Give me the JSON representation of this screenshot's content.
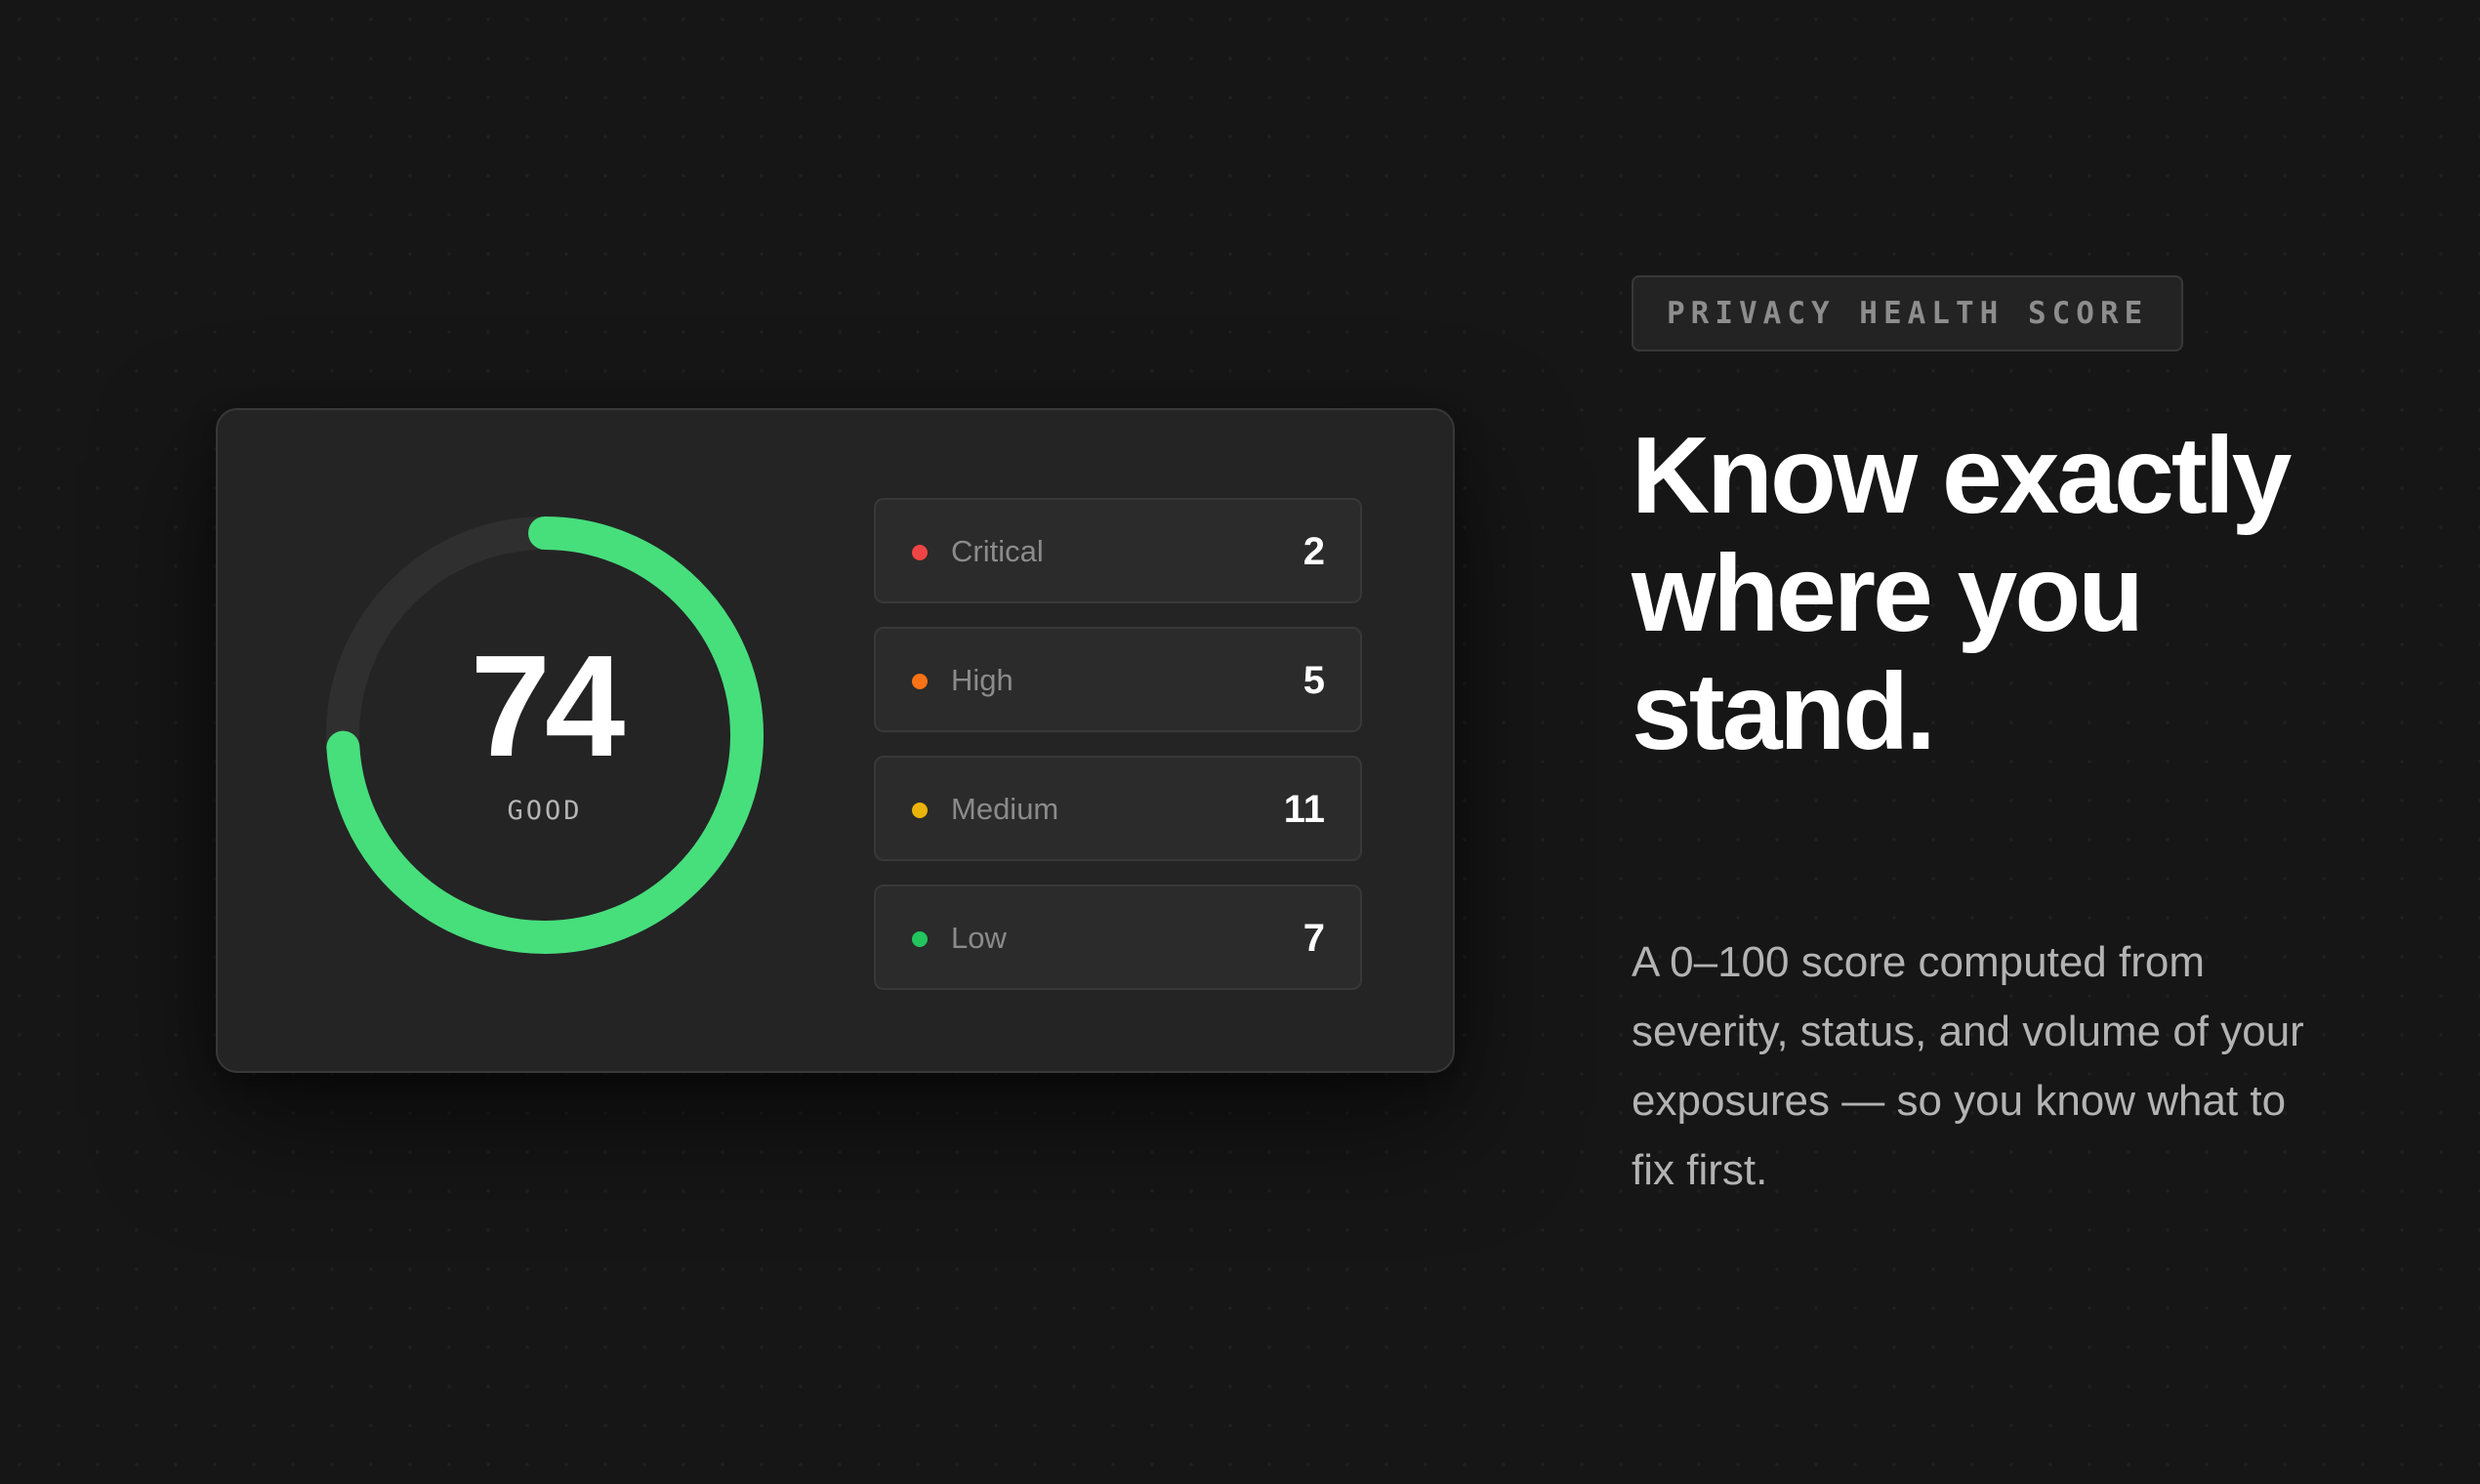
{
  "score_card": {
    "score": "74",
    "score_percent": 74,
    "rating": "GOOD",
    "accent_color": "#47de7c",
    "track_color": "#2f2f2f",
    "severities": [
      {
        "label": "Critical",
        "count": "2",
        "color": "#ef4444"
      },
      {
        "label": "High",
        "count": "5",
        "color": "#f97316"
      },
      {
        "label": "Medium",
        "count": "11",
        "color": "#eab308"
      },
      {
        "label": "Low",
        "count": "7",
        "color": "#22c55e"
      }
    ]
  },
  "hero": {
    "badge": "PRIVACY HEALTH SCORE",
    "headline": "Know exactly where you stand.",
    "description": "A 0–100 score computed from severity, status, and volume of your exposures — so you know what to fix first."
  }
}
